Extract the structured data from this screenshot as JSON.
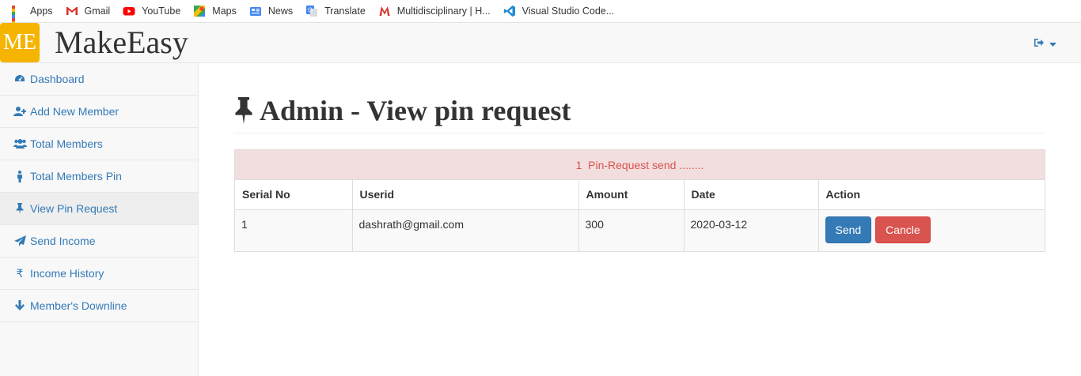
{
  "bookmarks": [
    {
      "label": "Apps",
      "icon": "apps-grid-icon"
    },
    {
      "label": "Gmail",
      "icon": "gmail-icon"
    },
    {
      "label": "YouTube",
      "icon": "youtube-icon"
    },
    {
      "label": "Maps",
      "icon": "maps-icon"
    },
    {
      "label": "News",
      "icon": "news-icon"
    },
    {
      "label": "Translate",
      "icon": "translate-icon"
    },
    {
      "label": "Multidisciplinary | H...",
      "icon": "m-icon"
    },
    {
      "label": "Visual Studio Code...",
      "icon": "vscode-icon"
    }
  ],
  "navbar": {
    "logo_text": "ME",
    "brand": "MakeEasy",
    "user_menu_icon": "sign-out-icon"
  },
  "sidebar": {
    "items": [
      {
        "label": "Dashboard",
        "icon": "dashboard-icon"
      },
      {
        "label": "Add New Member",
        "icon": "user-plus-icon"
      },
      {
        "label": "Total Members",
        "icon": "users-icon"
      },
      {
        "label": "Total Members Pin",
        "icon": "person-icon"
      },
      {
        "label": "View Pin Request",
        "icon": "thumbtack-icon",
        "active": true
      },
      {
        "label": "Send Income",
        "icon": "paper-plane-icon"
      },
      {
        "label": "Income History",
        "icon": "rupee-icon"
      },
      {
        "label": "Member's Downline",
        "icon": "arrow-down-icon"
      }
    ]
  },
  "main": {
    "title": "Admin - View pin request",
    "alert": "1  Pin-Request send ........",
    "table": {
      "headers": [
        "Serial No",
        "Userid",
        "Amount",
        "Date",
        "Action"
      ],
      "rows": [
        {
          "serial": "1",
          "userid": "dashrath@gmail.com",
          "amount": "300",
          "date": "2020-03-12",
          "send_label": "Send",
          "cancel_label": "Cancle"
        }
      ]
    }
  },
  "colors": {
    "logo_bg": "#f4b400",
    "link": "#337ab7",
    "alert_bg": "#f2dede",
    "alert_text": "#d9534f",
    "send_btn": "#337ab7",
    "cancel_btn": "#d9534f"
  }
}
